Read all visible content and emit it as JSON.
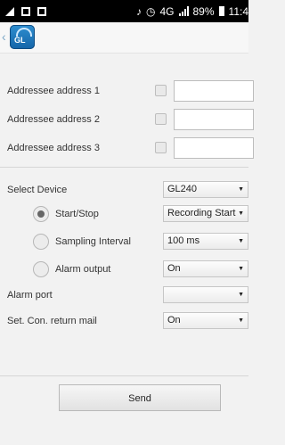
{
  "status_bar": {
    "battery": "89%",
    "time": "11:4",
    "network": "4G"
  },
  "app": {
    "logo_text": "GL"
  },
  "addressees": [
    {
      "label": "Addressee address 1",
      "value": ""
    },
    {
      "label": "Addressee address 2",
      "value": ""
    },
    {
      "label": "Addressee address 3",
      "value": ""
    }
  ],
  "device": {
    "label": "Select Device",
    "value": "GL240"
  },
  "options": [
    {
      "label": "Start/Stop",
      "value": "Recording Start",
      "selected": true
    },
    {
      "label": "Sampling Interval",
      "value": "100 ms",
      "selected": false
    },
    {
      "label": "Alarm output",
      "value": "On",
      "selected": false
    }
  ],
  "alarm_port": {
    "label": "Alarm port",
    "value": ""
  },
  "return_mail": {
    "label": "Set. Con. return mail",
    "value": "On"
  },
  "send_label": "Send"
}
